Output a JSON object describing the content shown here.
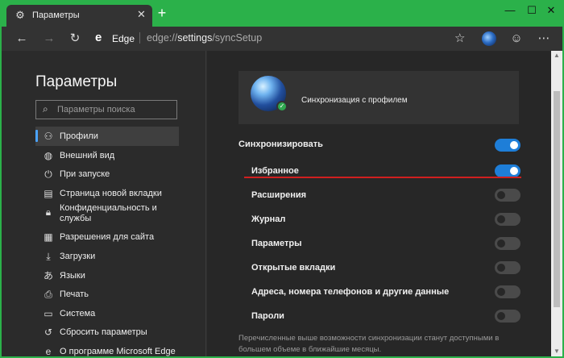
{
  "tab": {
    "title": "Параметры",
    "icon": "gear-icon",
    "close": "✕"
  },
  "new_tab": "+",
  "window_controls": {
    "minimize": "—",
    "maximize": "☐",
    "close": "✕"
  },
  "toolbar": {
    "browser_name": "Edge",
    "url_prefix": "edge://",
    "url_bold": "settings",
    "url_rest": "/syncSetup"
  },
  "sidebar": {
    "title": "Параметры",
    "search_placeholder": "Параметры поиска",
    "items": [
      {
        "label": "Профили",
        "icon": "person-icon",
        "glyph": "⚇",
        "active": true
      },
      {
        "label": "Внешний вид",
        "icon": "palette-icon",
        "glyph": "◍"
      },
      {
        "label": "При запуске",
        "icon": "power-icon",
        "glyph": "⏻"
      },
      {
        "label": "Страница новой вкладки",
        "icon": "newtab-icon",
        "glyph": "▤"
      },
      {
        "label": "Конфиденциальность и службы",
        "icon": "lock-icon",
        "glyph": "🔒︎",
        "tall": true
      },
      {
        "label": "Разрешения для сайта",
        "icon": "site-permissions-icon",
        "glyph": "▦"
      },
      {
        "label": "Загрузки",
        "icon": "download-icon",
        "glyph": "⤓"
      },
      {
        "label": "Языки",
        "icon": "language-icon",
        "glyph": "あ"
      },
      {
        "label": "Печать",
        "icon": "printer-icon",
        "glyph": "⎙"
      },
      {
        "label": "Система",
        "icon": "system-icon",
        "glyph": "▭"
      },
      {
        "label": "Сбросить параметры",
        "icon": "reset-icon",
        "glyph": "↺"
      },
      {
        "label": "О программе Microsoft Edge",
        "icon": "edge-icon",
        "glyph": "e"
      }
    ]
  },
  "profile": {
    "text": "Синхронизация с профилем"
  },
  "sync": {
    "heading": "Синхронизировать",
    "heading_on": true,
    "items": [
      {
        "label": "Избранное",
        "on": true
      },
      {
        "label": "Расширения",
        "on": false
      },
      {
        "label": "Журнал",
        "on": false
      },
      {
        "label": "Параметры",
        "on": false
      },
      {
        "label": "Открытые вкладки",
        "on": false
      },
      {
        "label": "Адреса, номера телефонов и другие данные",
        "on": false
      },
      {
        "label": "Пароли",
        "on": false
      }
    ],
    "footnote": "Перечисленные выше возможности синхронизации станут доступными в большем объеме в ближайшие месяцы."
  },
  "colors": {
    "accent": "#1e7ed8",
    "highlight_line": "#d01f1f",
    "frame": "#2bb14a"
  }
}
